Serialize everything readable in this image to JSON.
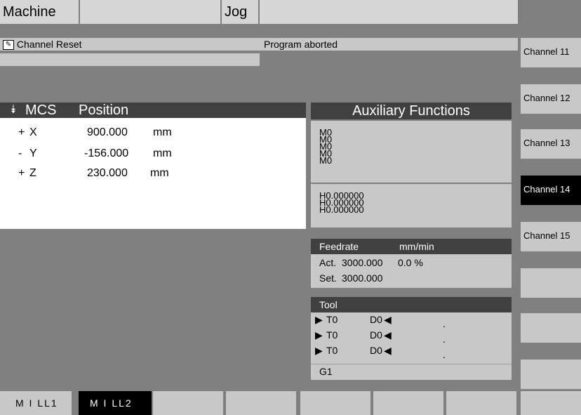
{
  "header": {
    "area": "Machine",
    "program_path": "",
    "mode": "Jog",
    "status_right": ""
  },
  "status": {
    "channel_state": "Channel Reset",
    "program_state": "Program aborted",
    "alarm_line": ""
  },
  "position": {
    "title_icon": "axis-icon",
    "title_a": "MCS",
    "title_b": "Position",
    "axes": [
      {
        "dir": "+",
        "name": "X",
        "value": "900.000",
        "unit": "mm"
      },
      {
        "dir": "-",
        "name": "Y",
        "value": "-156.000",
        "unit": "mm"
      },
      {
        "dir": "+",
        "name": "Z",
        "value": "230.000",
        "unit": "mm"
      }
    ]
  },
  "aux": {
    "title": "Auxiliary Functions",
    "m_functions": [
      "M0",
      "M0",
      "M0",
      "M0",
      "M0"
    ],
    "h_functions": [
      "H0.000000",
      "H0.000000",
      "H0.000000"
    ]
  },
  "feed": {
    "title": "Feedrate",
    "unit": "mm/min",
    "act_label": "Act.",
    "act_value": "3000.000",
    "act_percent": "0.0 %",
    "set_label": "Set.",
    "set_value": "3000.000"
  },
  "tool": {
    "title": "Tool",
    "rows": [
      {
        "t": "T0",
        "d": "D0"
      },
      {
        "t": "T0",
        "d": "D0"
      },
      {
        "t": "T0",
        "d": "D0"
      }
    ],
    "gcode": "G1"
  },
  "vertical_softkeys": [
    {
      "label": "Channel 11",
      "active": false
    },
    {
      "label": "Channel 12",
      "active": false
    },
    {
      "label": "Channel 13",
      "active": false
    },
    {
      "label": "Channel 14",
      "active": true
    },
    {
      "label": "Channel 15",
      "active": false
    },
    {
      "label": "",
      "active": false
    },
    {
      "label": "",
      "active": false
    },
    {
      "label": "",
      "active": false
    }
  ],
  "horizontal_softkeys": [
    {
      "label": "M I LL1",
      "active": false
    },
    {
      "label": "M I LL2",
      "active": true
    },
    {
      "label": "",
      "active": false
    },
    {
      "label": "",
      "active": false
    },
    {
      "label": "",
      "active": false
    },
    {
      "label": "",
      "active": false
    },
    {
      "label": "",
      "active": false
    },
    {
      "label": "",
      "active": false
    }
  ],
  "colors": {
    "background": "#808080",
    "panel_title": "#404040",
    "active_softkey": "#000000"
  }
}
